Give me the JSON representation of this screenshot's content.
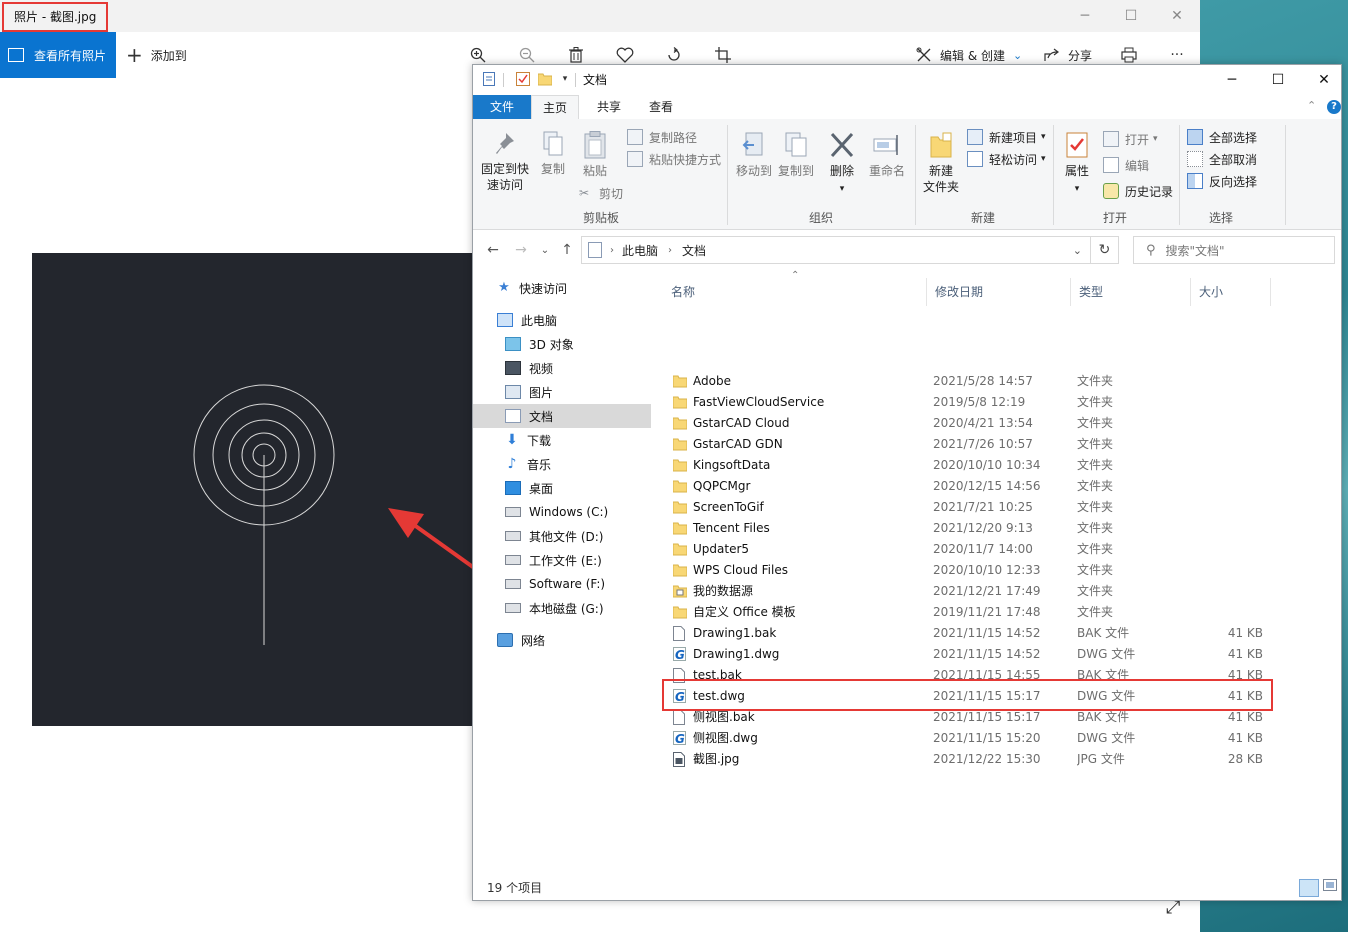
{
  "photos": {
    "title": "照片 - 截图.jpg",
    "view_all_label": "查看所有照片",
    "add_to_label": "添加到",
    "edit_create_label": "编辑 & 创建",
    "share_label": "分享",
    "more_label": "···"
  },
  "explorer": {
    "title": "文档",
    "tabs": [
      "文件",
      "主页",
      "共享",
      "查看"
    ],
    "ribbon": {
      "pin_label_1": "固定到快",
      "pin_label_2": "速访问",
      "copy_label": "复制",
      "paste_label": "粘贴",
      "copy_path_label": "复制路径",
      "paste_shortcut_label": "粘贴快捷方式",
      "cut_label": "剪切",
      "clipboard_group": "剪贴板",
      "move_to_label": "移动到",
      "copy_to_label": "复制到",
      "delete_label": "删除",
      "rename_label": "重命名",
      "organize_group": "组织",
      "new_folder_label_1": "新建",
      "new_folder_label_2": "文件夹",
      "new_item_label": "新建项目",
      "easy_access_label": "轻松访问",
      "new_group": "新建",
      "properties_label": "属性",
      "open_label": "打开",
      "edit_label": "编辑",
      "history_label": "历史记录",
      "open_group": "打开",
      "select_all_label": "全部选择",
      "select_none_label": "全部取消",
      "invert_selection_label": "反向选择",
      "select_group": "选择"
    },
    "breadcrumb": [
      "此电脑",
      "文档"
    ],
    "search_placeholder": "搜索\"文档\"",
    "nav": [
      {
        "label": "快速访问",
        "icon": "star-icon"
      },
      {
        "label": "此电脑",
        "icon": "pc-icon"
      },
      {
        "label": "3D 对象",
        "icon": "cube-icon"
      },
      {
        "label": "视频",
        "icon": "video-icon"
      },
      {
        "label": "图片",
        "icon": "picture-icon"
      },
      {
        "label": "文档",
        "icon": "document-icon"
      },
      {
        "label": "下载",
        "icon": "download-icon"
      },
      {
        "label": "音乐",
        "icon": "music-icon"
      },
      {
        "label": "桌面",
        "icon": "desktop-icon"
      },
      {
        "label": "Windows (C:)",
        "icon": "drive-icon"
      },
      {
        "label": "其他文件 (D:)",
        "icon": "drive-icon"
      },
      {
        "label": "工作文件 (E:)",
        "icon": "drive-icon"
      },
      {
        "label": "Software (F:)",
        "icon": "drive-icon"
      },
      {
        "label": "本地磁盘 (G:)",
        "icon": "drive-icon"
      },
      {
        "label": "网络",
        "icon": "network-icon"
      }
    ],
    "columns": {
      "name": "名称",
      "date": "修改日期",
      "type": "类型",
      "size": "大小"
    },
    "files": [
      {
        "name": "Adobe",
        "date": "2021/5/28 14:57",
        "type": "文件夹",
        "size": "",
        "kind": "folder"
      },
      {
        "name": "FastViewCloudService",
        "date": "2019/5/8 12:19",
        "type": "文件夹",
        "size": "",
        "kind": "folder"
      },
      {
        "name": "GstarCAD Cloud",
        "date": "2020/4/21 13:54",
        "type": "文件夹",
        "size": "",
        "kind": "folder"
      },
      {
        "name": "GstarCAD GDN",
        "date": "2021/7/26 10:57",
        "type": "文件夹",
        "size": "",
        "kind": "folder"
      },
      {
        "name": "KingsoftData",
        "date": "2020/10/10 10:34",
        "type": "文件夹",
        "size": "",
        "kind": "folder"
      },
      {
        "name": "QQPCMgr",
        "date": "2020/12/15 14:56",
        "type": "文件夹",
        "size": "",
        "kind": "folder"
      },
      {
        "name": "ScreenToGif",
        "date": "2021/7/21 10:25",
        "type": "文件夹",
        "size": "",
        "kind": "folder"
      },
      {
        "name": "Tencent Files",
        "date": "2021/12/20 9:13",
        "type": "文件夹",
        "size": "",
        "kind": "folder"
      },
      {
        "name": "Updater5",
        "date": "2020/11/7 14:00",
        "type": "文件夹",
        "size": "",
        "kind": "folder"
      },
      {
        "name": "WPS Cloud Files",
        "date": "2020/10/10 12:33",
        "type": "文件夹",
        "size": "",
        "kind": "folder"
      },
      {
        "name": "我的数据源",
        "date": "2021/12/21 17:49",
        "type": "文件夹",
        "size": "",
        "kind": "datasource"
      },
      {
        "name": "自定义 Office 模板",
        "date": "2019/11/21 17:48",
        "type": "文件夹",
        "size": "",
        "kind": "folder"
      },
      {
        "name": "Drawing1.bak",
        "date": "2021/11/15 14:52",
        "type": "BAK 文件",
        "size": "41 KB",
        "kind": "file"
      },
      {
        "name": "Drawing1.dwg",
        "date": "2021/11/15 14:52",
        "type": "DWG 文件",
        "size": "41 KB",
        "kind": "dwg"
      },
      {
        "name": "test.bak",
        "date": "2021/11/15 14:55",
        "type": "BAK 文件",
        "size": "41 KB",
        "kind": "file"
      },
      {
        "name": "test.dwg",
        "date": "2021/11/15 15:17",
        "type": "DWG 文件",
        "size": "41 KB",
        "kind": "dwg"
      },
      {
        "name": "侧视图.bak",
        "date": "2021/11/15 15:17",
        "type": "BAK 文件",
        "size": "41 KB",
        "kind": "file"
      },
      {
        "name": "侧视图.dwg",
        "date": "2021/11/15 15:20",
        "type": "DWG 文件",
        "size": "41 KB",
        "kind": "dwg"
      },
      {
        "name": "截图.jpg",
        "date": "2021/12/22 15:30",
        "type": "JPG 文件",
        "size": "28 KB",
        "kind": "image"
      }
    ],
    "status": "19 个项目"
  },
  "colors": {
    "accent": "#1979ca",
    "highlight": "#e53935",
    "folder": "#f8d775"
  }
}
